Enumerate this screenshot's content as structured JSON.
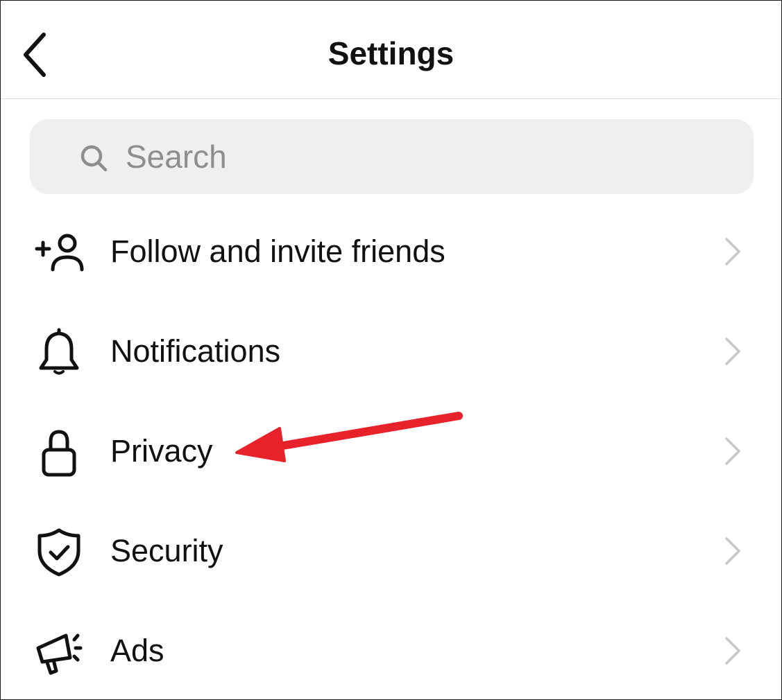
{
  "header": {
    "title": "Settings",
    "back_icon": "chevron-left-icon"
  },
  "search": {
    "placeholder": "Search",
    "value": "",
    "icon": "search-icon"
  },
  "menu": {
    "items": [
      {
        "label": "Follow and invite friends",
        "icon": "add-person-icon"
      },
      {
        "label": "Notifications",
        "icon": "bell-icon"
      },
      {
        "label": "Privacy",
        "icon": "lock-icon"
      },
      {
        "label": "Security",
        "icon": "shield-check-icon"
      },
      {
        "label": "Ads",
        "icon": "megaphone-icon"
      }
    ],
    "chevron_icon": "chevron-right-icon"
  },
  "annotation": {
    "color": "#e8222b",
    "points_to": "Privacy"
  },
  "colors": {
    "text": "#111111",
    "search_bg": "#efefef",
    "placeholder": "#8e8e8e",
    "chevron": "#c7c7c7",
    "divider": "#dcdcdc"
  }
}
